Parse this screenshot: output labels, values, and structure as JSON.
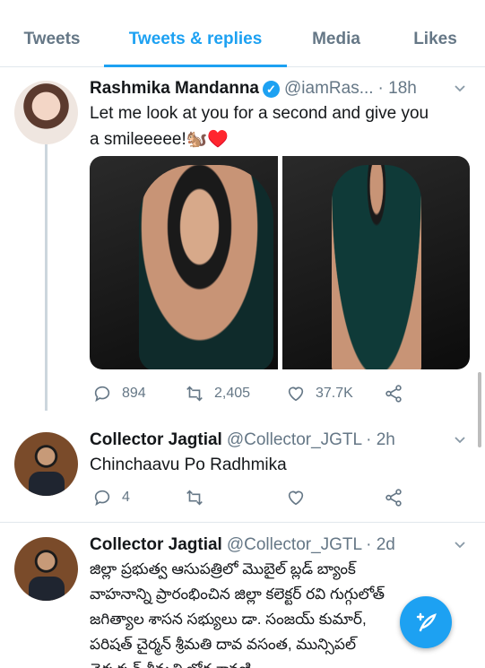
{
  "tabs": [
    {
      "label": "Tweets",
      "active": false
    },
    {
      "label": "Tweets & replies",
      "active": true
    },
    {
      "label": "Media",
      "active": false
    },
    {
      "label": "Likes",
      "active": false
    }
  ],
  "tweets": [
    {
      "name": "Rashmika Mandanna",
      "verified": true,
      "handle": "@iamRas...",
      "time": "· 18h",
      "text_line1": "Let me look at you for a second and give you",
      "text_line2": "a smileeeee!🐿️♥️",
      "replies": "894",
      "retweets": "2,405",
      "likes": "37.7K"
    },
    {
      "name": "Collector Jagtial",
      "handle": "@Collector_JGTL",
      "time": "· 2h",
      "text": "Chinchaavu Po Radhmika",
      "replies": "4",
      "retweets": "",
      "likes": ""
    },
    {
      "name": "Collector Jagtial",
      "handle": "@Collector_JGTL",
      "time": "· 2d",
      "lines": [
        "జిల్లా ప్రభుత్వ ఆసుపత్రిలో మొబైల్ బ్లడ్ బ్యాంక్",
        "వాహనాన్ని ప్రారంభించిన జిల్లా కలెక్టర్ రవి గుగ్గులోత్",
        "జగిత్యాల శాసన సభ్యులు డా. సంజయ్ కుమార్,",
        "పరిషత్ చైర్మన్ శ్రీమతి దావ వసంత, మున్సిపల్",
        "చైర్పర్సన్ శ్రీమతి బోగ శ్రావణి"
      ]
    }
  ],
  "colors": {
    "accent": "#1da1f2",
    "muted": "#657786",
    "divider": "#e1e8ed"
  }
}
